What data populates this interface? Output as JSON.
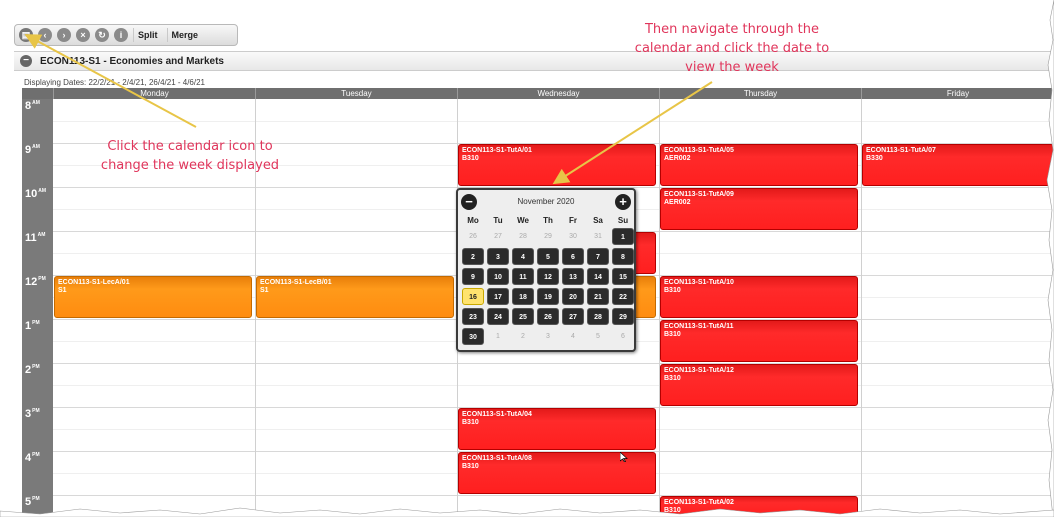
{
  "toolbar": {
    "icons": [
      "calendar-icon",
      "back-icon",
      "forward-icon",
      "close-icon",
      "refresh-icon",
      "info-icon"
    ],
    "split_label": "Split",
    "merge_label": "Merge"
  },
  "course": {
    "title": "ECON113-S1 - Economies and Markets"
  },
  "displaying_dates": "Displaying Dates: 22/2/21 - 2/4/21, 26/4/21 - 4/6/21",
  "days": [
    "Monday",
    "Tuesday",
    "Wednesday",
    "Thursday",
    "Friday"
  ],
  "times": [
    {
      "hour": "8",
      "ampm": "AM"
    },
    {
      "hour": "9",
      "ampm": "AM"
    },
    {
      "hour": "10",
      "ampm": "AM"
    },
    {
      "hour": "11",
      "ampm": "AM"
    },
    {
      "hour": "12",
      "ampm": "PM"
    },
    {
      "hour": "1",
      "ampm": "PM"
    },
    {
      "hour": "2",
      "ampm": "PM"
    },
    {
      "hour": "3",
      "ampm": "PM"
    },
    {
      "hour": "4",
      "ampm": "PM"
    },
    {
      "hour": "5",
      "ampm": "PM"
    }
  ],
  "events": [
    {
      "code": "ECON113-S1-TutA/01",
      "room": "B310",
      "color": "red"
    },
    {
      "code": "ECON113-S1-TutA/05",
      "room": "AER002",
      "color": "red"
    },
    {
      "code": "ECON113-S1-TutA/07",
      "room": "B330",
      "color": "red"
    },
    {
      "code": "ECON113-S1-TutA/09",
      "room": "AER002",
      "color": "red"
    },
    {
      "code": "ECON113-S1-LecA/01",
      "room": "S1",
      "color": "orange"
    },
    {
      "code": "ECON113-S1-LecB/01",
      "room": "S1",
      "color": "orange"
    },
    {
      "code": "ECON113-S1-TutA/10",
      "room": "B310",
      "color": "red"
    },
    {
      "code": "ECON113-S1-TutA/11",
      "room": "B310",
      "color": "red"
    },
    {
      "code": "ECON113-S1-TutA/12",
      "room": "B310",
      "color": "red"
    },
    {
      "code": "ECON113-S1-TutA/04",
      "room": "B310",
      "color": "red"
    },
    {
      "code": "ECON113-S1-TutA/08",
      "room": "B310",
      "color": "red"
    },
    {
      "code": "ECON113-S1-TutA/02",
      "room": "B310",
      "color": "red"
    }
  ],
  "datepicker": {
    "month_label": "November 2020",
    "prev_label": "−",
    "next_label": "+",
    "weekdays": [
      "Mo",
      "Tu",
      "We",
      "Th",
      "Fr",
      "Sa",
      "Su"
    ],
    "weeks": [
      [
        "26",
        "27",
        "28",
        "29",
        "30",
        "31",
        "1"
      ],
      [
        "2",
        "3",
        "4",
        "5",
        "6",
        "7",
        "8"
      ],
      [
        "9",
        "10",
        "11",
        "12",
        "13",
        "14",
        "15"
      ],
      [
        "16",
        "17",
        "18",
        "19",
        "20",
        "21",
        "22"
      ],
      [
        "23",
        "24",
        "25",
        "26",
        "27",
        "28",
        "29"
      ],
      [
        "30",
        "1",
        "2",
        "3",
        "4",
        "5",
        "6"
      ]
    ],
    "today": "16"
  },
  "annotations": {
    "left_line1": "Click the calendar icon to",
    "left_line2": "change the week displayed",
    "right_line1": "Then navigate through the",
    "right_line2": "calendar and click the date to",
    "right_line3": "view the week"
  },
  "colors": {
    "event_red": "#ff2020",
    "event_orange": "#ff8c10",
    "annotation": "#e0355b",
    "arrow": "#e8c547",
    "today_highlight": "#ffe36e"
  }
}
